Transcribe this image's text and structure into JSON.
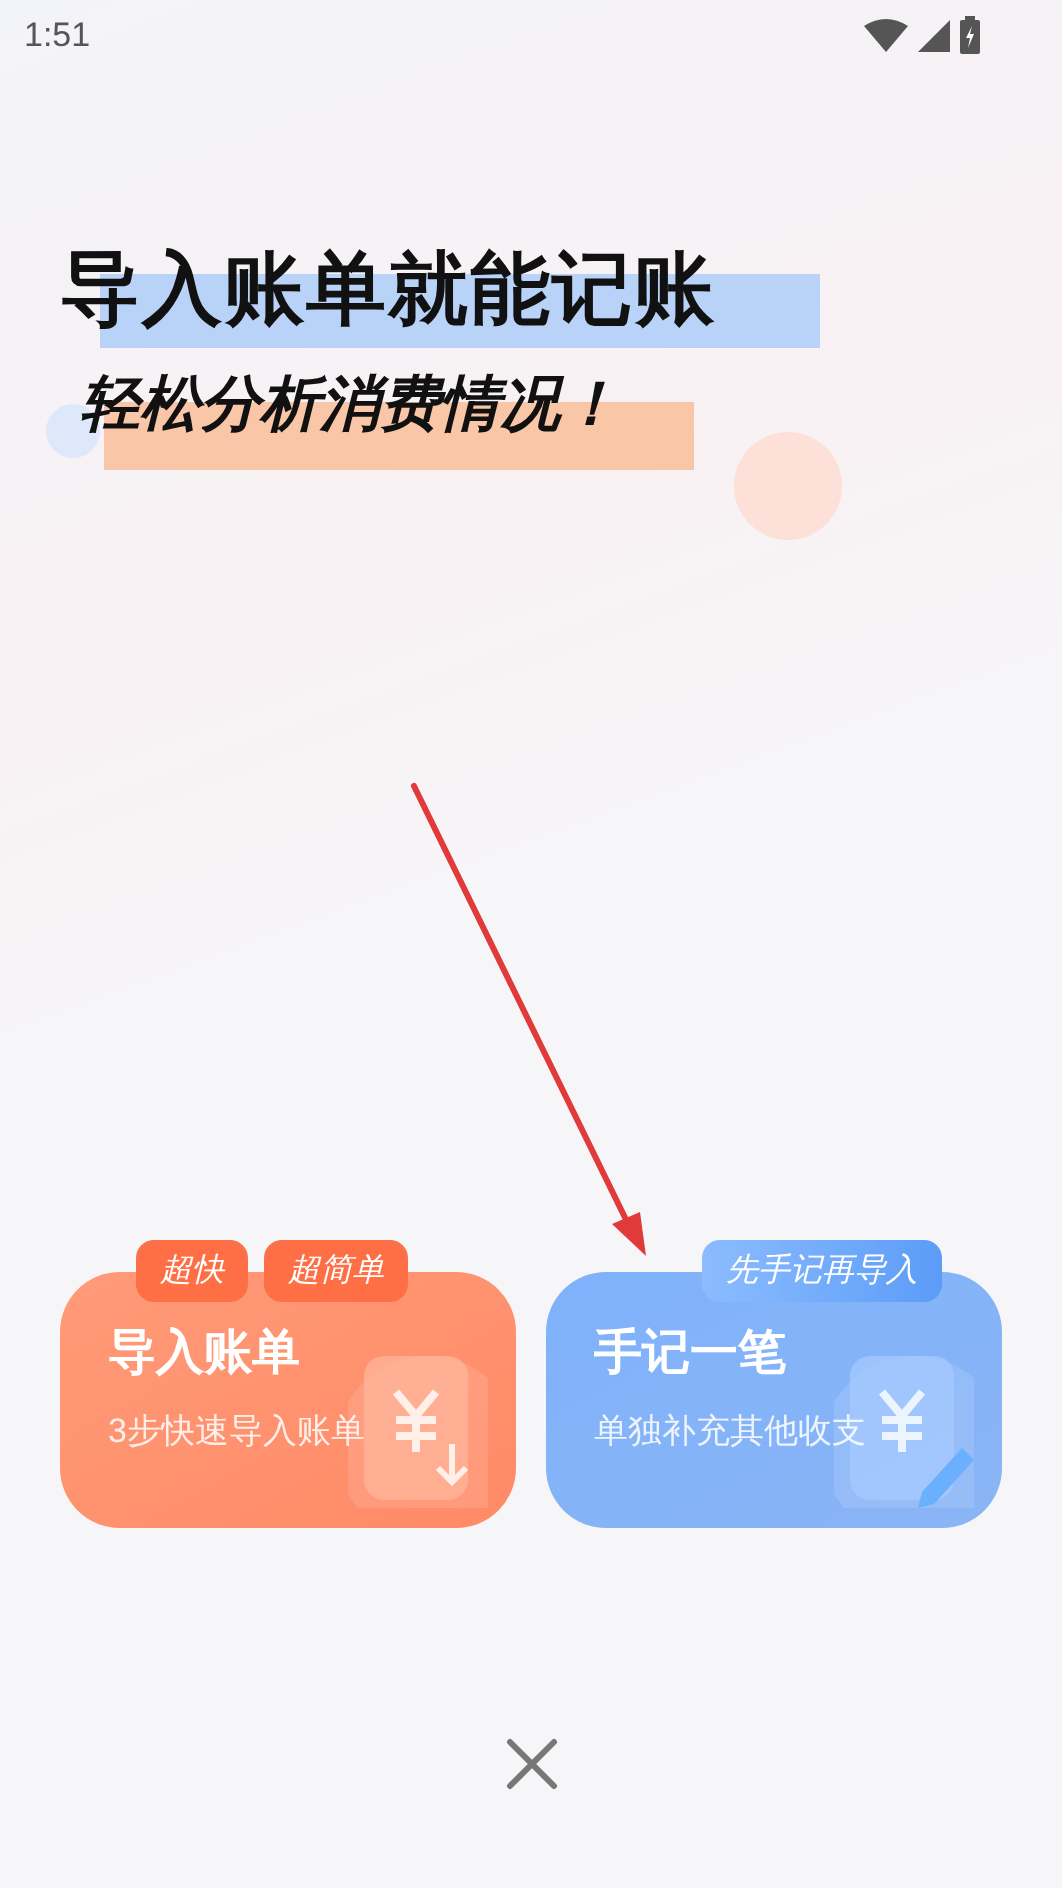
{
  "status_bar": {
    "time": "1:51"
  },
  "headline": {
    "title": "导入账单就能记账",
    "subtitle": "轻松分析消费情况！"
  },
  "cards": [
    {
      "kind": "import",
      "title": "导入账单",
      "subtitle": "3步快速导入账单",
      "tags": [
        "超快",
        "超简单"
      ]
    },
    {
      "kind": "manual",
      "title": "手记一笔",
      "subtitle": "单独补充其他收支",
      "tags": [
        "先手记再导入"
      ]
    }
  ]
}
